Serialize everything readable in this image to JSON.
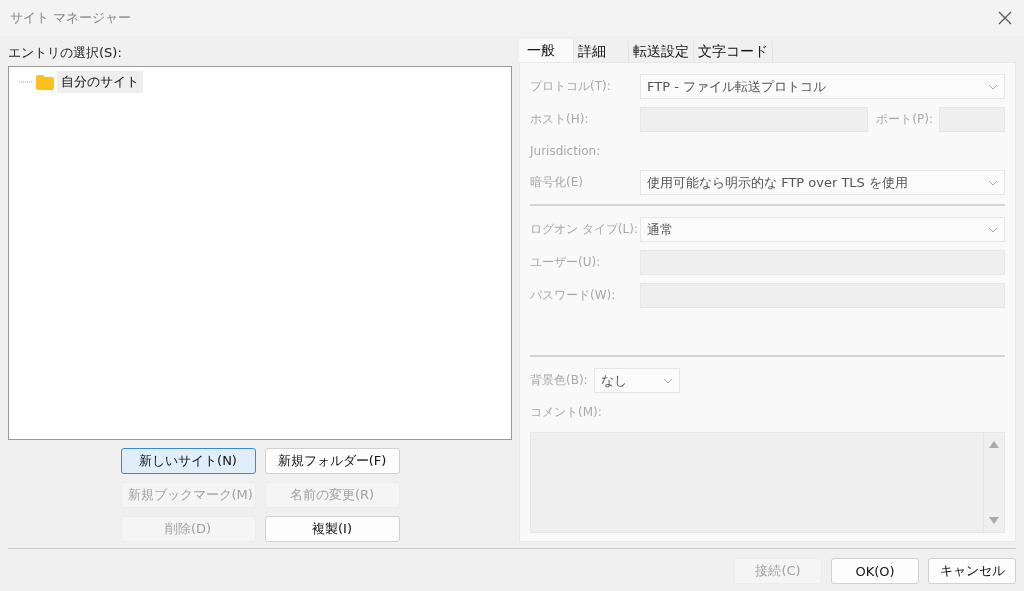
{
  "window": {
    "title": "サイト マネージャー"
  },
  "entries": {
    "label": "エントリの選択(S):",
    "tree": [
      {
        "label": "自分のサイト",
        "selected": true
      }
    ]
  },
  "left_buttons": [
    {
      "label": "新しいサイト(N)",
      "disabled": false,
      "selected": true
    },
    {
      "label": "新規フォルダー(F)",
      "disabled": false,
      "selected": false
    },
    {
      "label": "新規ブックマーク(M)",
      "disabled": true,
      "selected": false
    },
    {
      "label": "名前の変更(R)",
      "disabled": true,
      "selected": false
    },
    {
      "label": "削除(D)",
      "disabled": true,
      "selected": false
    },
    {
      "label": "複製(I)",
      "disabled": false,
      "selected": false
    }
  ],
  "tabs": [
    {
      "label": "一般",
      "selected": true
    },
    {
      "label": "詳細",
      "selected": false
    },
    {
      "label": "転送設定",
      "selected": false
    },
    {
      "label": "文字コード",
      "selected": false
    }
  ],
  "general": {
    "disabled": true,
    "fields": [
      {
        "kind": "dropdown",
        "label": "プロトコル(T):",
        "value": "FTP - ファイル転送プロトコル"
      },
      {
        "kind": "pair",
        "label": "ホスト(H):",
        "second_label": "ポート(P):"
      },
      {
        "kind": "label",
        "label": "Jurisdiction:"
      },
      {
        "kind": "dropdown",
        "label": "暗号化(E)",
        "value": "使用可能なら明示的な FTP over TLS を使用"
      },
      {
        "kind": "divider"
      },
      {
        "kind": "dropdown",
        "label": "ログオン タイプ(L):",
        "value": "通常"
      },
      {
        "kind": "text",
        "label": "ユーザー(U):"
      },
      {
        "kind": "text",
        "label": "パスワード(W):"
      },
      {
        "kind": "spacer"
      },
      {
        "kind": "divider"
      },
      {
        "kind": "small_dropdown",
        "label": "背景色(B):",
        "value": "なし"
      },
      {
        "kind": "label",
        "label": "コメント(M):"
      },
      {
        "kind": "textarea"
      }
    ]
  },
  "bottom_buttons": [
    {
      "label": "接続(C)",
      "disabled": true
    },
    {
      "label": "OK(O)",
      "disabled": false
    },
    {
      "label": "キャンセル",
      "disabled": false
    }
  ]
}
